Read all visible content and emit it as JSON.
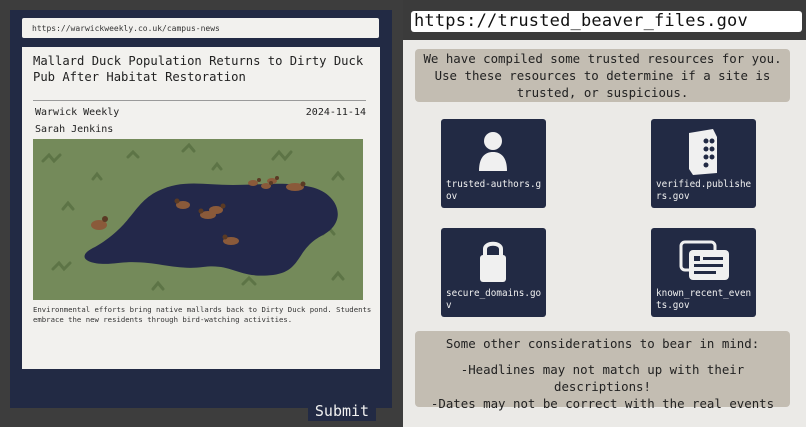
{
  "article": {
    "url": "https://warwickweekly.co.uk/campus-news",
    "title": "Mallard Duck Population Returns to Dirty Duck Pub After Habitat Restoration",
    "publication": "Warwick Weekly",
    "date": "2024-11-14",
    "author": "Sarah Jenkins",
    "caption": "Environmental efforts bring native mallards back to Dirty Duck pond. Students embrace the new residents through bird-watching activities."
  },
  "submit_label": "Submit",
  "resources": {
    "url": "https://trusted_beaver_files.gov",
    "intro": "We have compiled some trusted resources for you. Use these resources to determine if a site is trusted, or suspicious.",
    "tiles": [
      {
        "label": "trusted-authors.gov",
        "icon": "person-icon"
      },
      {
        "label": "verified.publishers.gov",
        "icon": "publisher-book-icon"
      },
      {
        "label": "secure_domains.gov",
        "icon": "lock-icon"
      },
      {
        "label": "known_recent_events.gov",
        "icon": "news-cards-icon"
      }
    ],
    "considerations": {
      "heading": "Some other considerations to bear in mind:",
      "items": [
        "-Headlines may not match up with their descriptions!",
        "-Dates may not be correct with the real events"
      ]
    }
  },
  "colors": {
    "navy": "#222a44",
    "card": "#f2f1ee",
    "info_box": "#c3bdb2",
    "grass": "#748a5a",
    "pond": "#23284a"
  }
}
